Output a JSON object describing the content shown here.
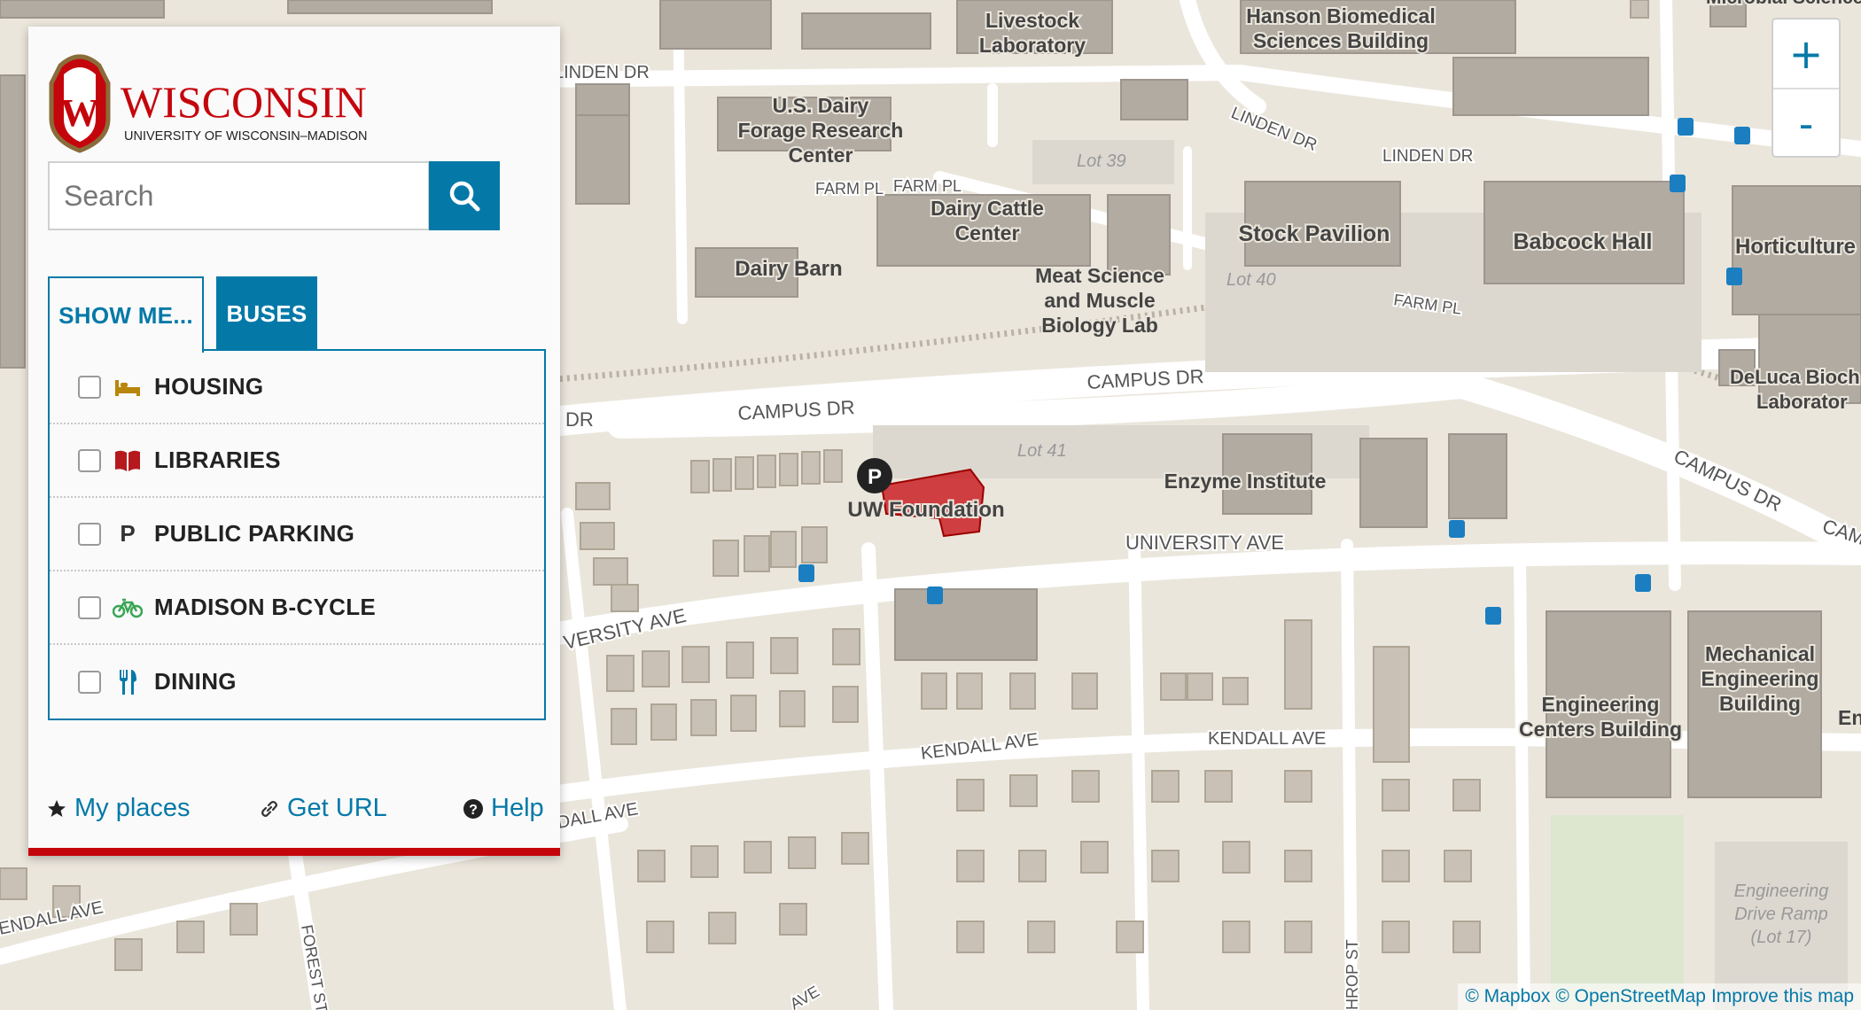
{
  "panel": {
    "logo": {
      "wordmark": "WISCONSIN",
      "subtitle": "UNIVERSITY OF WISCONSIN–MADISON",
      "crest_letter": "W"
    },
    "search": {
      "placeholder": "Search",
      "value": ""
    },
    "tabs": [
      {
        "label": "SHOW ME...",
        "active": true
      },
      {
        "label": "BUSES",
        "active": false
      }
    ],
    "layers": [
      {
        "label": "HOUSING",
        "icon": "bed-icon",
        "color": "#b8860b",
        "checked": false
      },
      {
        "label": "LIBRARIES",
        "icon": "book-icon",
        "color": "#b5191e",
        "checked": false
      },
      {
        "label": "PUBLIC PARKING",
        "icon": "parking-icon",
        "glyph": "P",
        "color": "#333333",
        "checked": false
      },
      {
        "label": "MADISON B-CYCLE",
        "icon": "bicycle-icon",
        "color": "#3aa655",
        "checked": false
      },
      {
        "label": "DINING",
        "icon": "fork-knife-icon",
        "color": "#0479a8",
        "checked": false
      }
    ],
    "footer": {
      "my_places": "My places",
      "get_url": "Get URL",
      "help": "Help"
    }
  },
  "zoom": {
    "in": "+",
    "out": "-"
  },
  "attribution": {
    "mapbox": "© Mapbox",
    "osm": "© OpenStreetMap",
    "improve": "Improve this map"
  },
  "map": {
    "buildings": {
      "livestock": [
        "Livestock",
        "Laboratory"
      ],
      "hanson": [
        "Hanson Biomedical",
        "Sciences Building"
      ],
      "microbial": "Microbial Sciences",
      "dairy_research": [
        "U.S. Dairy",
        "Forage Research",
        "Center"
      ],
      "dairy_cattle": [
        "Dairy Cattle",
        "Center"
      ],
      "dairy_barn": "Dairy Barn",
      "meat_science": [
        "Meat Science",
        "and Muscle",
        "Biology Lab"
      ],
      "stock_pavilion": "Stock Pavilion",
      "babcock": "Babcock Hall",
      "horticulture": "Horticulture",
      "deluca": [
        "DeLuca Bioch",
        "Laborator"
      ],
      "enzyme": "Enzyme Institute",
      "uw_foundation": "UW Foundation",
      "mech_eng": [
        "Mechanical",
        "Engineering",
        "Building"
      ],
      "eng_centers": [
        "Engineering",
        "Centers Building"
      ],
      "eng_partial": "En",
      "eng_ramp": [
        "Engineering",
        "Drive Ramp",
        "(Lot 17)"
      ]
    },
    "lots": {
      "lot39": "Lot 39",
      "lot40": "Lot 40",
      "lot41": "Lot 41"
    },
    "streets": {
      "linden_w": "LINDEN DR",
      "linden_diag": "LINDEN DR",
      "linden_e": "LINDEN DR",
      "farm_pl_a": "FARM PL",
      "farm_pl_b": "FARM PL",
      "farm_pl_c": "FARM PL",
      "campus_w": "DR",
      "campus_1": "CAMPUS DR",
      "campus_2": "CAMPUS DR",
      "campus_3": "CAMPUS DR",
      "campus_4": "CAM",
      "univ_1": "UNIVERSITY AVE",
      "univ_2": "VERSITY AVE",
      "kendall_1": "KENDALL AVE",
      "kendall_2": "KENDALL AVE",
      "kendall_3": "DALL AVE",
      "kendall_4": "ENDALL AVE",
      "forest": "FOREST ST",
      "thrhop": "HROP ST",
      "ave_bottom": "AVE"
    },
    "marker": "P"
  }
}
